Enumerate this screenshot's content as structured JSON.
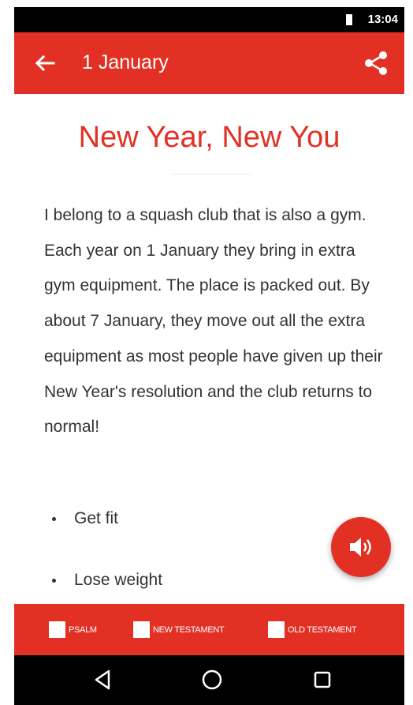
{
  "status_bar": {
    "time": "13:04"
  },
  "app_bar": {
    "title": "1 January"
  },
  "article": {
    "headline": "New Year, New You",
    "paragraph": "I belong to a squash club that is also a gym. Each year on 1 January they bring in extra gym equipment. The place is packed out. By about 7 January, they move out all the extra equipment as most people have given up their New Year's resolution and the club returns to normal!",
    "bullets": [
      "Get fit",
      "Lose weight"
    ]
  },
  "filters": {
    "psalm": "PSALM",
    "new_testament": "NEW TESTAMENT",
    "old_testament": "OLD TESTAMENT"
  },
  "colors": {
    "accent": "#e23124"
  },
  "icons": [
    "back-arrow-icon",
    "share-icon",
    "speaker-icon",
    "nav-back-icon",
    "nav-home-icon",
    "nav-recents-icon"
  ]
}
